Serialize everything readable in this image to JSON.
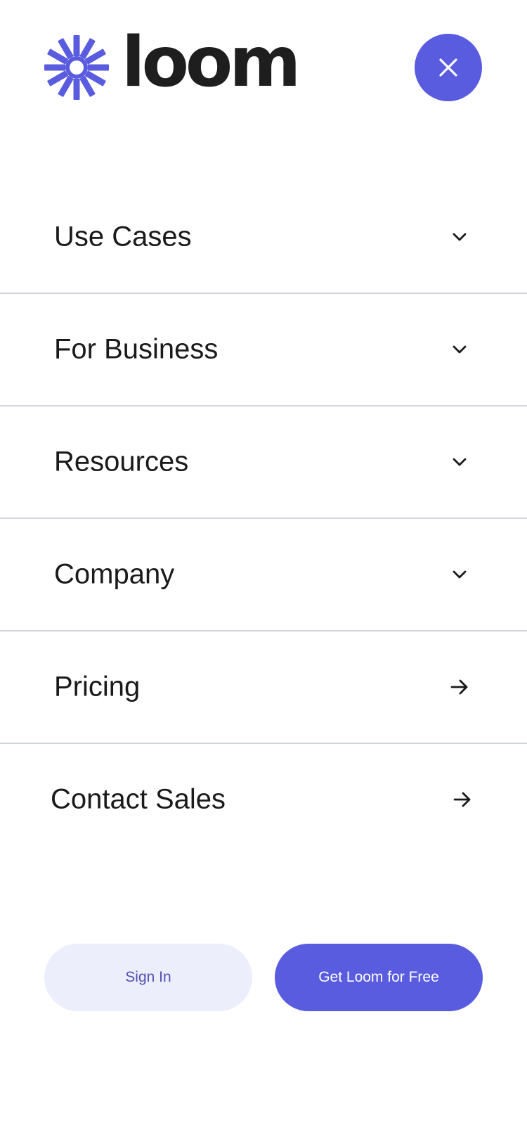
{
  "header": {
    "logo_text": "loom",
    "logo_icon": "loom-starburst-icon",
    "close_icon": "close-icon",
    "colors": {
      "brand": "#5a5ce0",
      "text": "#1a1a1a"
    }
  },
  "menu": {
    "items": [
      {
        "label": "Use Cases",
        "icon": "chevron-down-icon"
      },
      {
        "label": "For Business",
        "icon": "chevron-down-icon"
      },
      {
        "label": "Resources",
        "icon": "chevron-down-icon"
      },
      {
        "label": "Company",
        "icon": "chevron-down-icon"
      },
      {
        "label": "Pricing",
        "icon": "arrow-right-icon"
      },
      {
        "label": "Contact Sales",
        "icon": "arrow-right-icon"
      }
    ]
  },
  "actions": {
    "sign_in_label": "Sign In",
    "get_loom_label": "Get Loom for Free",
    "colors": {
      "primary": "#5a5ce0",
      "secondary_bg": "#eceefc"
    }
  }
}
